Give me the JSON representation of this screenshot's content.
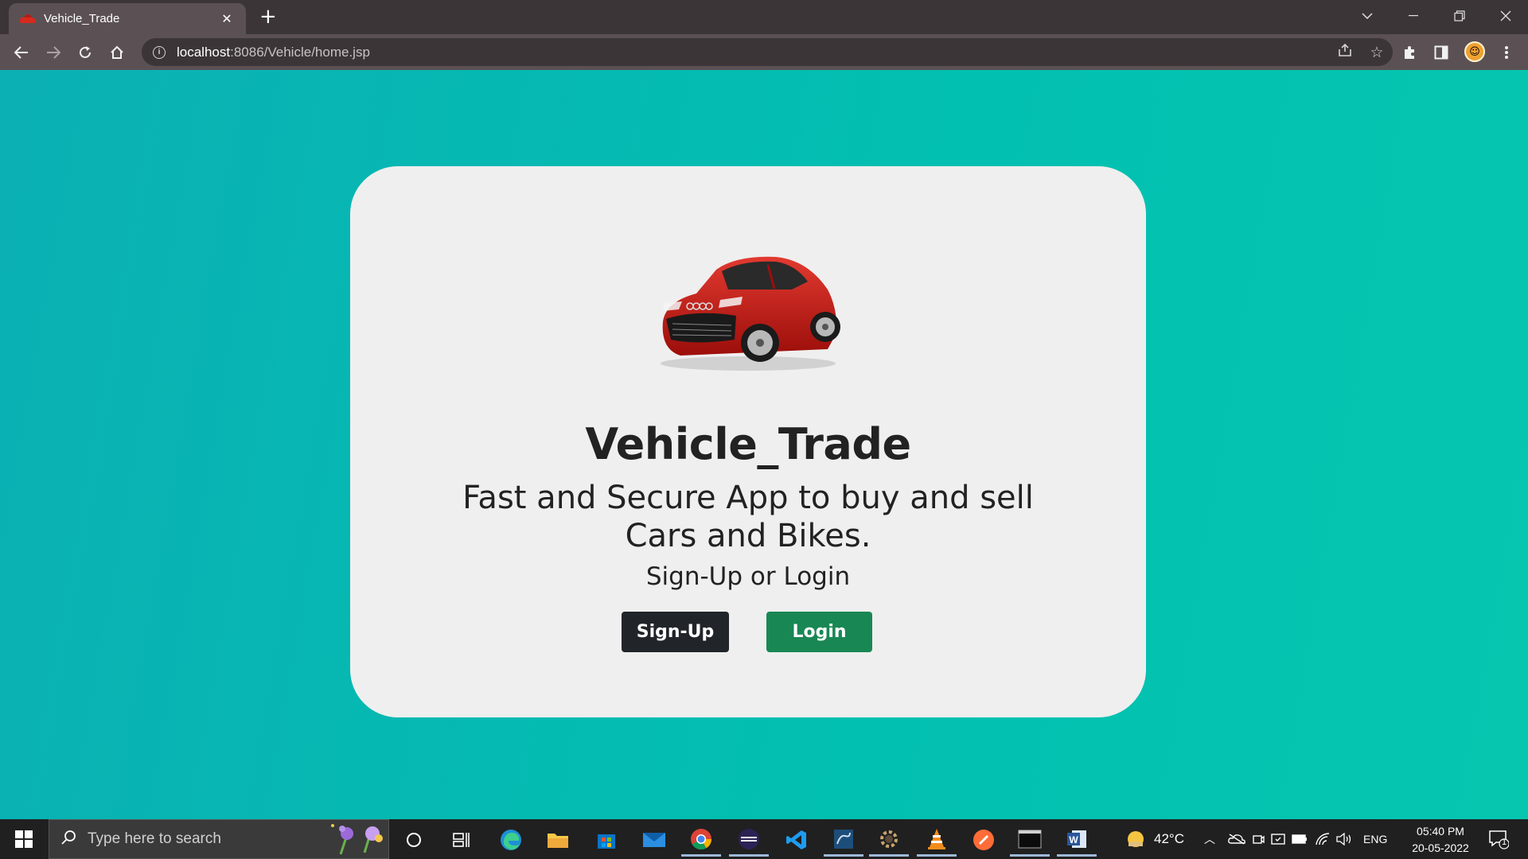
{
  "browser": {
    "tab_title": "Vehicle_Trade",
    "tab_close": "✕",
    "new_tab": "+",
    "url_host": "localhost",
    "url_rest": ":8086/Vehicle/home.jsp",
    "window_controls": [
      "﹀",
      "—",
      "❐",
      "✕"
    ]
  },
  "page": {
    "title": "Vehicle_Trade",
    "tagline": "Fast and Secure App to buy and sell Cars and Bikes.",
    "prompt": "Sign-Up or Login",
    "signup_label": "Sign-Up",
    "login_label": "Login",
    "colors": {
      "signup": "#212529",
      "login": "#198754",
      "card": "#efefef",
      "background": "#02bfb1"
    }
  },
  "taskbar": {
    "search_placeholder": "Type here to search",
    "weather": "42°C",
    "language": "ENG",
    "time": "05:40 PM",
    "date": "20-05-2022",
    "notification_count": "1"
  }
}
